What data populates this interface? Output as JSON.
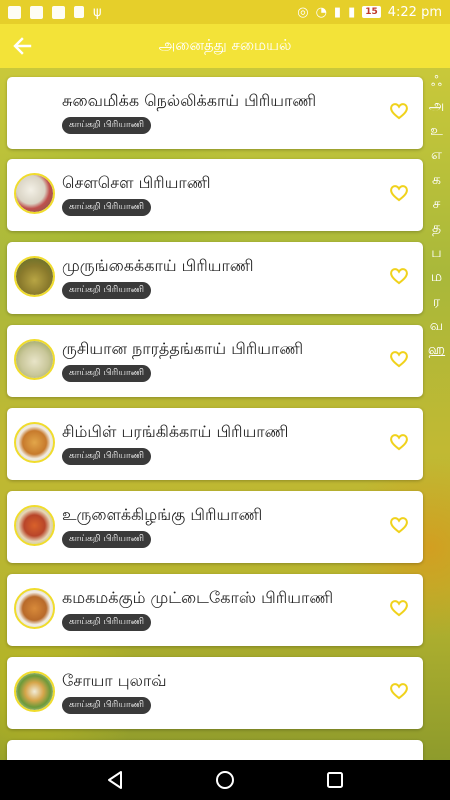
{
  "status_bar": {
    "time": "4:22 pm",
    "battery": "15"
  },
  "app_bar": {
    "title": "அனைத்து சமையல்"
  },
  "recipes": [
    {
      "title": "சுவைமிக்க நெல்லிக்காய் பிரியாணி",
      "category": "காய்கறி பிரியாணி",
      "has_image": false
    },
    {
      "title": "சௌசௌ பிரியாணி",
      "category": "காய்கறி பிரியாணி",
      "has_image": true
    },
    {
      "title": "முருங்கைக்காய் பிரியாணி",
      "category": "காய்கறி பிரியாணி",
      "has_image": true
    },
    {
      "title": "ருசியான நாரத்தங்காய் பிரியாணி",
      "category": "காய்கறி பிரியாணி",
      "has_image": true
    },
    {
      "title": "சிம்பிள் பரங்கிக்காய் பிரியாணி",
      "category": "காய்கறி பிரியாணி",
      "has_image": true
    },
    {
      "title": "உருளைக்கிழங்கு பிரியாணி",
      "category": "காய்கறி பிரியாணி",
      "has_image": true
    },
    {
      "title": "கமகமக்கும் முட்டைகோஸ் பிரியாணி",
      "category": "காய்கறி பிரியாணி",
      "has_image": true
    },
    {
      "title": "சோயா புலாவ்",
      "category": "காய்கறி பிரியாணி",
      "has_image": true
    }
  ],
  "az_index": [
    "ஃ",
    "அ",
    "உ",
    "எ",
    "க",
    "ச",
    "த",
    "ப",
    "ம",
    "ர",
    "வ",
    "ஹ"
  ],
  "colors": {
    "app_bar": "#f3e338",
    "status_bar": "#e6cf2a",
    "favorite": "#f0d21c",
    "badge": "#3a3a3a"
  }
}
